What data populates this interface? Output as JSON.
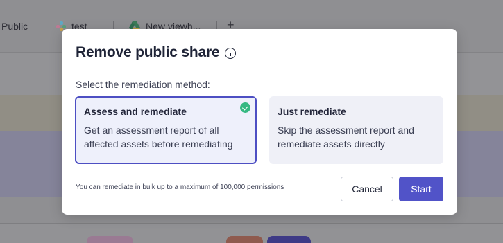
{
  "background": {
    "tabs": [
      {
        "label": "Public",
        "icon": "none"
      },
      {
        "label": "test",
        "icon": "slack-icon"
      },
      {
        "label": "New viewh...",
        "icon": "google-drive-icon"
      }
    ],
    "add_tab_glyph": "+",
    "colors": {
      "overlay": "#8c8c8f",
      "tag_1": "#9a7a93",
      "tag_2": "#8f5a4e",
      "tag_3": "#3e3a86"
    }
  },
  "modal": {
    "title": "Remove public share",
    "title_icon": "info-icon",
    "subtitle": "Select the remediation method:",
    "options": [
      {
        "title": "Assess and remediate",
        "description": "Get an assessment report of all affected assets before remediating",
        "selected": true,
        "selected_icon": "check-circle-icon"
      },
      {
        "title": "Just remediate",
        "description": "Skip the assessment report and remediate assets directly",
        "selected": false
      }
    ],
    "footnote": "You can remediate in bulk up to a maximum of 100,000 permissions",
    "buttons": {
      "cancel": "Cancel",
      "start": "Start"
    },
    "colors": {
      "accent": "#5153c8",
      "selected_border": "#4d4fc3",
      "check": "#35b882",
      "title": "#1f2437"
    }
  }
}
